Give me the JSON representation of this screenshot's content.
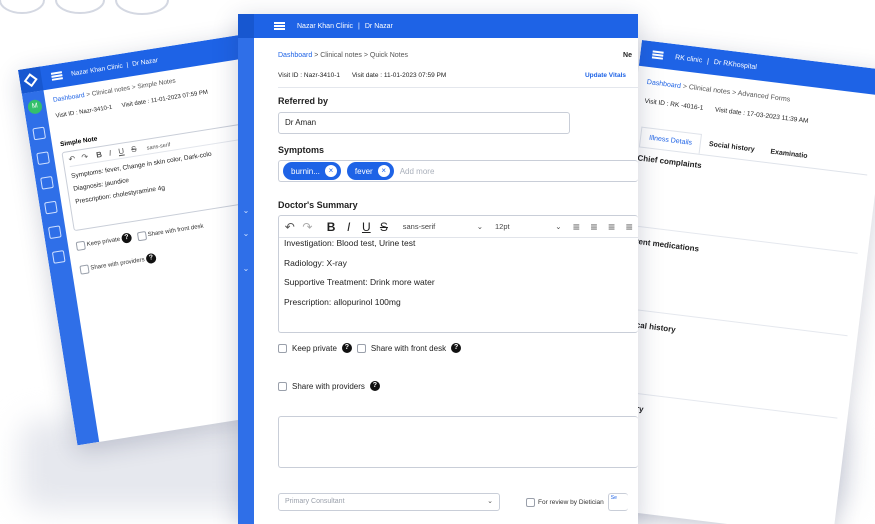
{
  "left_card": {
    "clinic": "Nazar Khan Clinic",
    "doctor": "Dr Nazar",
    "avatar_initial": "M",
    "breadcrumb": {
      "dashboard": "Dashboard",
      "clinical": "Clinical notes",
      "current": "Simple Notes"
    },
    "visit_id": "Visit ID : Nazr-3410-1",
    "visit_date": "Visit date : 11-01-2023 07:59 PM",
    "section_title": "Simple Note",
    "font_value": "sans-serif",
    "lines": [
      "Symptoms: fever, Change in skin color, Dark-colo",
      "Diagnosis: jaundice",
      "Prescription: cholestyramine 4g"
    ],
    "keep_private": "Keep private",
    "share_front_desk": "Share with front desk",
    "share_providers": "Share with providers"
  },
  "center_card": {
    "clinic": "Nazar Khan Clinic",
    "doctor": "Dr Nazar",
    "breadcrumb": {
      "dashboard": "Dashboard",
      "clinical": "Clinical notes",
      "current": "Quick Notes"
    },
    "corner_text": "Ne",
    "visit_id": "Visit ID : Nazr-3410-1",
    "visit_date": "Visit date : 11-01-2023 07:59 PM",
    "update_vitals": "Update Vitals",
    "referred_label": "Referred by",
    "referred_value": "Dr Aman",
    "symptoms_label": "Symptoms",
    "chips": [
      "burnin...",
      "fever"
    ],
    "add_more_placeholder": "Add more",
    "summary_label": "Doctor's Summary",
    "font_value": "sans-serif",
    "size_value": "12pt",
    "lines": [
      "Investigation: Blood test, Urine test",
      "Radiology: X-ray",
      "Supportive Treatment: Drink more water",
      "Prescription: allopurinol 100mg"
    ],
    "keep_private": "Keep private",
    "share_front_desk": "Share with front desk",
    "share_providers": "Share with providers",
    "primary_consultant_placeholder": "Primary Consultant",
    "review_label": "For review by Dietician",
    "corner_small": "Se"
  },
  "right_card": {
    "clinic": "RK clinic",
    "doctor": "Dr RKhospital",
    "breadcrumb": {
      "dashboard": "Dashboard",
      "clinical": "Clinical notes",
      "current": "Advanced Forms"
    },
    "visit_id": "Visit ID : RK -4016-1",
    "visit_date": "Visit date : 17-03-2023 11:39 AM",
    "tabs": [
      "Illness Details",
      "Social history",
      "Examinatio"
    ],
    "sections": [
      "Chief complaints",
      "urrent medications",
      "medical history",
      "Summary"
    ]
  },
  "colors": {
    "primary": "#1e63e6",
    "sidebar": "#2f6fe8",
    "avatar": "#33c06b"
  }
}
